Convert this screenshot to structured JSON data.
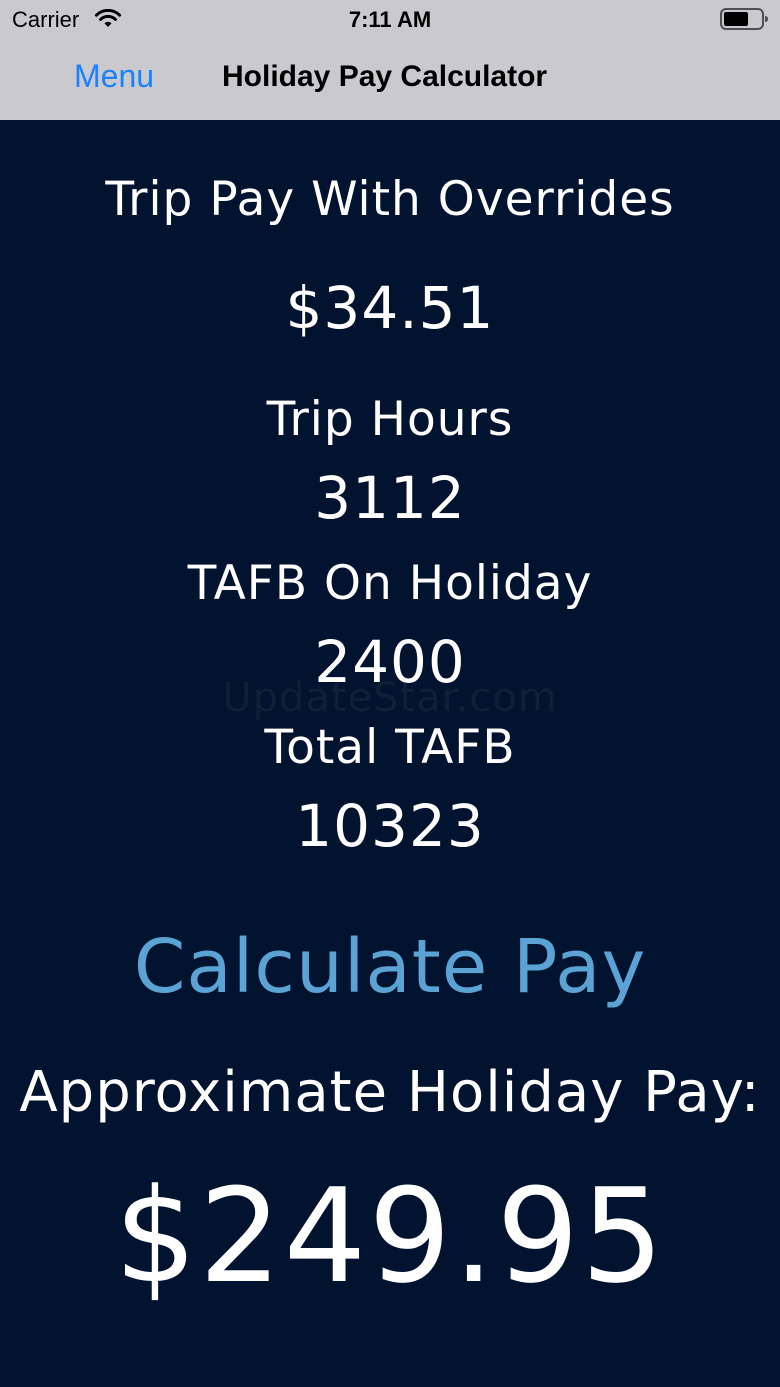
{
  "status_bar": {
    "carrier": "Carrier",
    "time": "7:11 AM"
  },
  "nav": {
    "back_label": "Menu",
    "title": "Holiday Pay Calculator"
  },
  "trip_pay": {
    "label": "Trip Pay With Overrides",
    "value": "$34.51"
  },
  "trip_hours": {
    "label": "Trip Hours",
    "value": "3112"
  },
  "tafb_holiday": {
    "label": "TAFB On Holiday",
    "value": "2400"
  },
  "total_tafb": {
    "label": "Total TAFB",
    "value": "10323"
  },
  "watermark": "UpdateStar.com",
  "calculate_label": "Calculate Pay",
  "result": {
    "label": "Approximate Holiday Pay:",
    "value": "$249.95"
  },
  "colors": {
    "background": "#021330",
    "navbar": "#c9c9ce",
    "link_blue": "#1a82fb",
    "calculate_blue": "#5aa3d4",
    "text": "#ffffff"
  },
  "icons": {
    "signal": "wifi-icon",
    "battery": "battery-icon"
  }
}
